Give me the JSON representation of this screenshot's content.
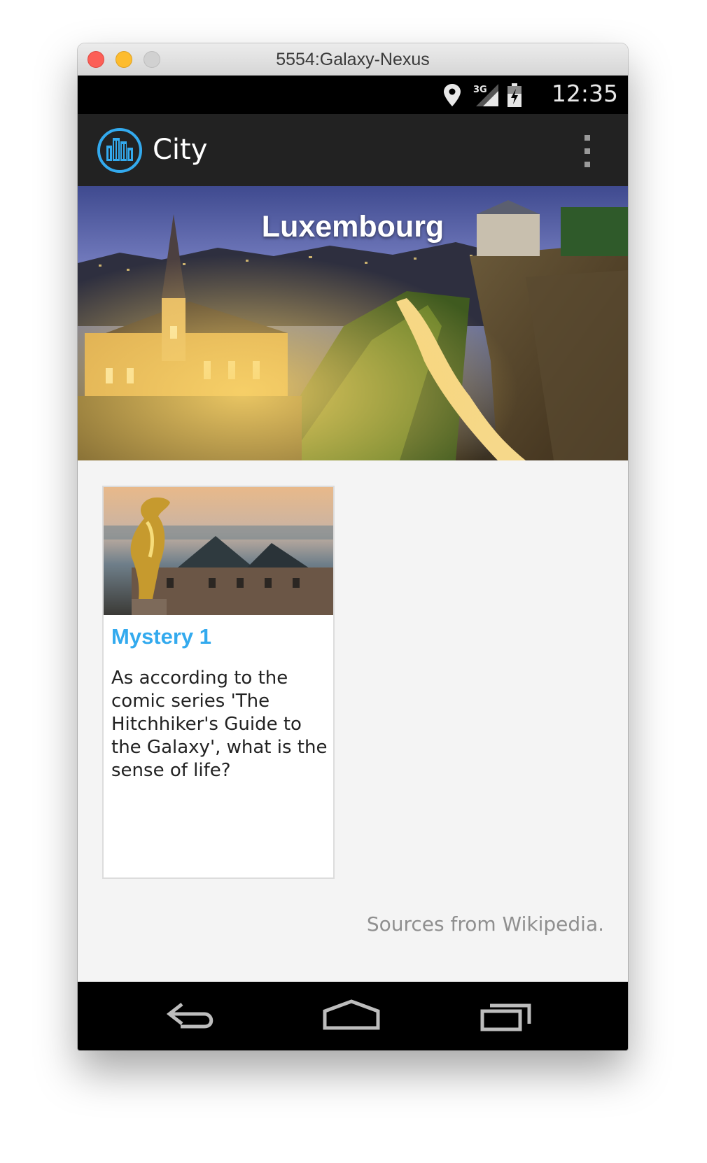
{
  "window": {
    "title": "5554:Galaxy-Nexus"
  },
  "statusbar": {
    "time": "12:35",
    "network_label": "3G",
    "icons": [
      "location-pin-icon",
      "signal-3g-icon",
      "battery-icon"
    ]
  },
  "actionbar": {
    "title": "City",
    "logo_icon": "city-buildings-icon",
    "menu_icon": "overflow-menu-icon"
  },
  "hero": {
    "title": "Luxembourg"
  },
  "cards": [
    {
      "title": "Mystery 1",
      "text": "As according to the comic series 'The Hitchhiker's Guide to the Galaxy', what is the sense of life?"
    }
  ],
  "footer": {
    "sources": "Sources from Wikipedia."
  },
  "navbar": {
    "buttons": [
      "back-icon",
      "home-icon",
      "recent-apps-icon"
    ]
  },
  "colors": {
    "accent": "#33aaee",
    "actionbar": "#222222",
    "background": "#f4f4f4"
  }
}
